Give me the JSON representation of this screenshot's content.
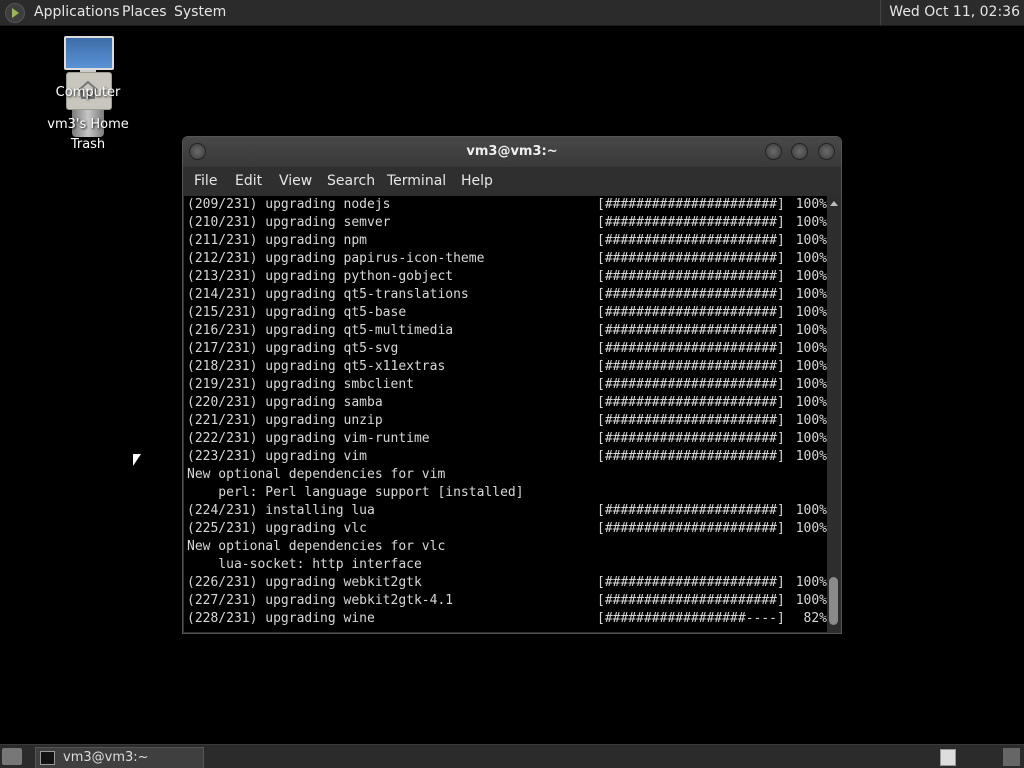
{
  "top_panel": {
    "menu": [
      "Applications",
      "Places",
      "System"
    ],
    "clock": "Wed Oct 11, 02:36"
  },
  "desktop": {
    "icons": [
      {
        "label": "Computer",
        "icon": "computer-icon"
      },
      {
        "label": "vm3's Home",
        "icon": "home-folder-icon"
      },
      {
        "label": "Trash",
        "icon": "trash-icon"
      }
    ]
  },
  "window": {
    "title": "vm3@vm3:~",
    "menu": [
      "File",
      "Edit",
      "View",
      "Search",
      "Terminal",
      "Help"
    ]
  },
  "terminal": {
    "lines": [
      {
        "text": "(209/231) upgrading nodejs",
        "bar": "[######################]",
        "pct": "100%"
      },
      {
        "text": "(210/231) upgrading semver",
        "bar": "[######################]",
        "pct": "100%"
      },
      {
        "text": "(211/231) upgrading npm",
        "bar": "[######################]",
        "pct": "100%"
      },
      {
        "text": "(212/231) upgrading papirus-icon-theme",
        "bar": "[######################]",
        "pct": "100%"
      },
      {
        "text": "(213/231) upgrading python-gobject",
        "bar": "[######################]",
        "pct": "100%"
      },
      {
        "text": "(214/231) upgrading qt5-translations",
        "bar": "[######################]",
        "pct": "100%"
      },
      {
        "text": "(215/231) upgrading qt5-base",
        "bar": "[######################]",
        "pct": "100%"
      },
      {
        "text": "(216/231) upgrading qt5-multimedia",
        "bar": "[######################]",
        "pct": "100%"
      },
      {
        "text": "(217/231) upgrading qt5-svg",
        "bar": "[######################]",
        "pct": "100%"
      },
      {
        "text": "(218/231) upgrading qt5-x11extras",
        "bar": "[######################]",
        "pct": "100%"
      },
      {
        "text": "(219/231) upgrading smbclient",
        "bar": "[######################]",
        "pct": "100%"
      },
      {
        "text": "(220/231) upgrading samba",
        "bar": "[######################]",
        "pct": "100%"
      },
      {
        "text": "(221/231) upgrading unzip",
        "bar": "[######################]",
        "pct": "100%"
      },
      {
        "text": "(222/231) upgrading vim-runtime",
        "bar": "[######################]",
        "pct": "100%"
      },
      {
        "text": "(223/231) upgrading vim",
        "bar": "[######################]",
        "pct": "100%"
      },
      {
        "text": "New optional dependencies for vim",
        "bar": "",
        "pct": ""
      },
      {
        "text": "    perl: Perl language support [installed]",
        "bar": "",
        "pct": ""
      },
      {
        "text": "(224/231) installing lua",
        "bar": "[######################]",
        "pct": "100%"
      },
      {
        "text": "(225/231) upgrading vlc",
        "bar": "[######################]",
        "pct": "100%"
      },
      {
        "text": "New optional dependencies for vlc",
        "bar": "",
        "pct": ""
      },
      {
        "text": "    lua-socket: http interface",
        "bar": "",
        "pct": ""
      },
      {
        "text": "(226/231) upgrading webkit2gtk",
        "bar": "[######################]",
        "pct": "100%"
      },
      {
        "text": "(227/231) upgrading webkit2gtk-4.1",
        "bar": "[######################]",
        "pct": "100%"
      },
      {
        "text": "(228/231) upgrading wine",
        "bar": "[##################----]",
        "pct": "82%"
      }
    ]
  },
  "taskbar": {
    "task_label": "vm3@vm3:~"
  }
}
